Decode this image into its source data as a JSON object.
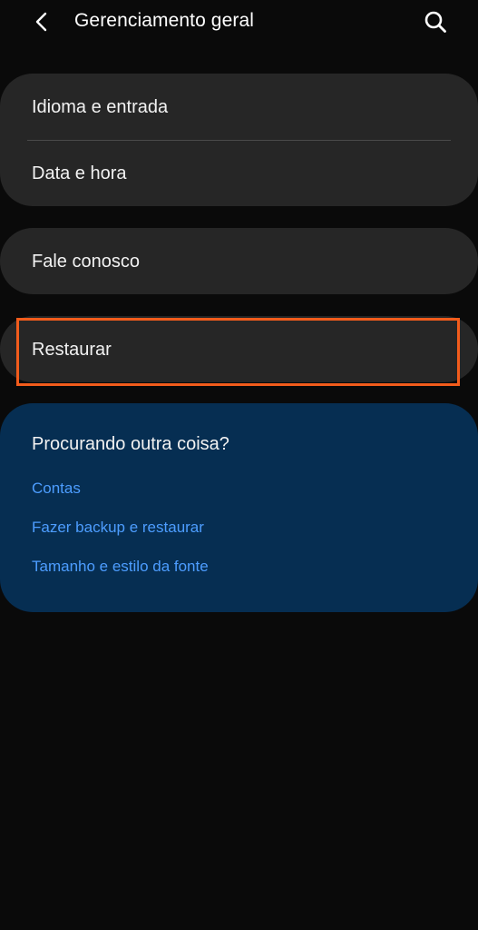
{
  "header": {
    "title": "Gerenciamento geral",
    "back_icon": "chevron-left-icon",
    "search_icon": "search-icon"
  },
  "settings": {
    "group1": [
      "Idioma e entrada",
      "Data e hora"
    ],
    "contact": "Fale conosco",
    "reset": "Restaurar"
  },
  "suggestions": {
    "title": "Procurando outra coisa?",
    "links": [
      "Contas",
      "Fazer backup e restaurar",
      "Tamanho e estilo da fonte"
    ]
  },
  "colors": {
    "background": "#0a0a0a",
    "card": "#262626",
    "suggest_bg": "#062e52",
    "link": "#4d9dff",
    "highlight": "#f25c1c"
  }
}
